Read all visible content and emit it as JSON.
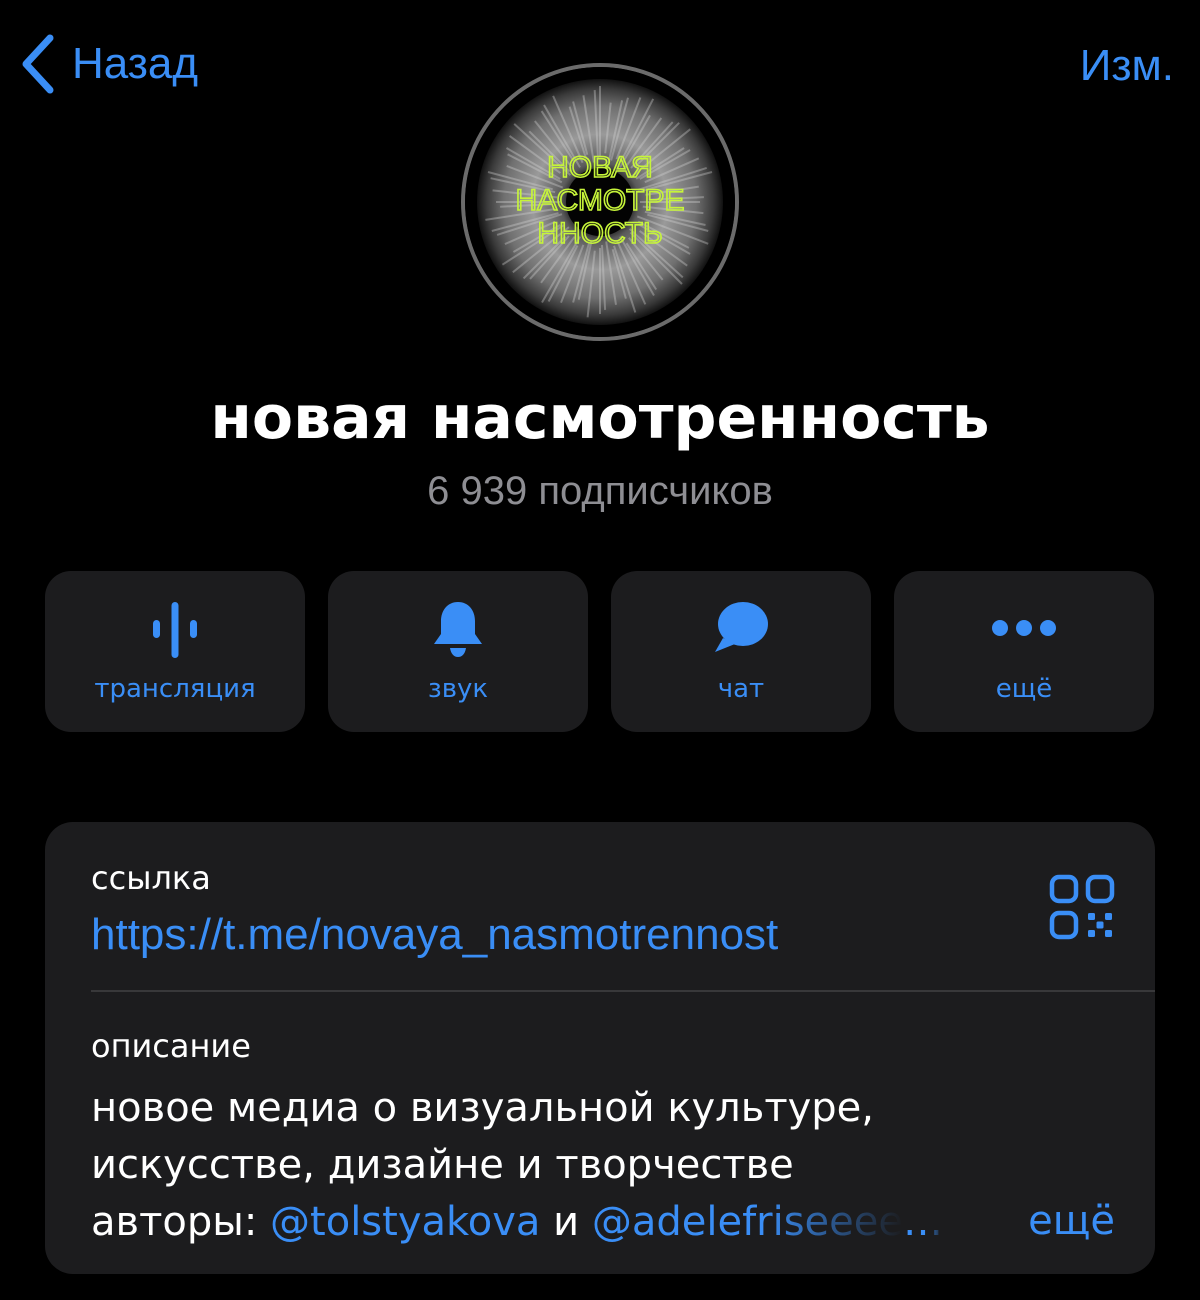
{
  "nav": {
    "back_label": "Назад",
    "edit_label": "Изм."
  },
  "avatar": {
    "logo_lines": [
      "НОВАЯ",
      "НАСМОТРЕ",
      "ННОСТЬ"
    ]
  },
  "channel": {
    "title": "новая насмотренность",
    "subscribers": "6 939 подписчиков"
  },
  "actions": [
    {
      "label": "трансляция",
      "icon": "voice-chat-icon"
    },
    {
      "label": "звук",
      "icon": "bell-icon"
    },
    {
      "label": "чат",
      "icon": "chat-bubble-icon"
    },
    {
      "label": "ещё",
      "icon": "more-dots-icon"
    }
  ],
  "info": {
    "link_caption": "ссылка",
    "link": "https://t.me/novaya_nasmotrennost",
    "qr_icon": "qr-code-icon",
    "description_caption": "описание",
    "description_line1": "новое медиа о визуальной культуре,",
    "description_line2": "искусстве, дизайне и творчестве",
    "authors_prefix": "авторы: ",
    "author1": "@tolstyakova",
    "conjunction": " и ",
    "author2": "@adelefriseeee",
    "ellipsis": "…",
    "more_label": "ещё"
  },
  "colors": {
    "background": "#000000",
    "card": "#1c1c1e",
    "accent": "#3a8ef6",
    "secondary_text": "#8e8e93",
    "logo_green": "#c6f43a"
  }
}
